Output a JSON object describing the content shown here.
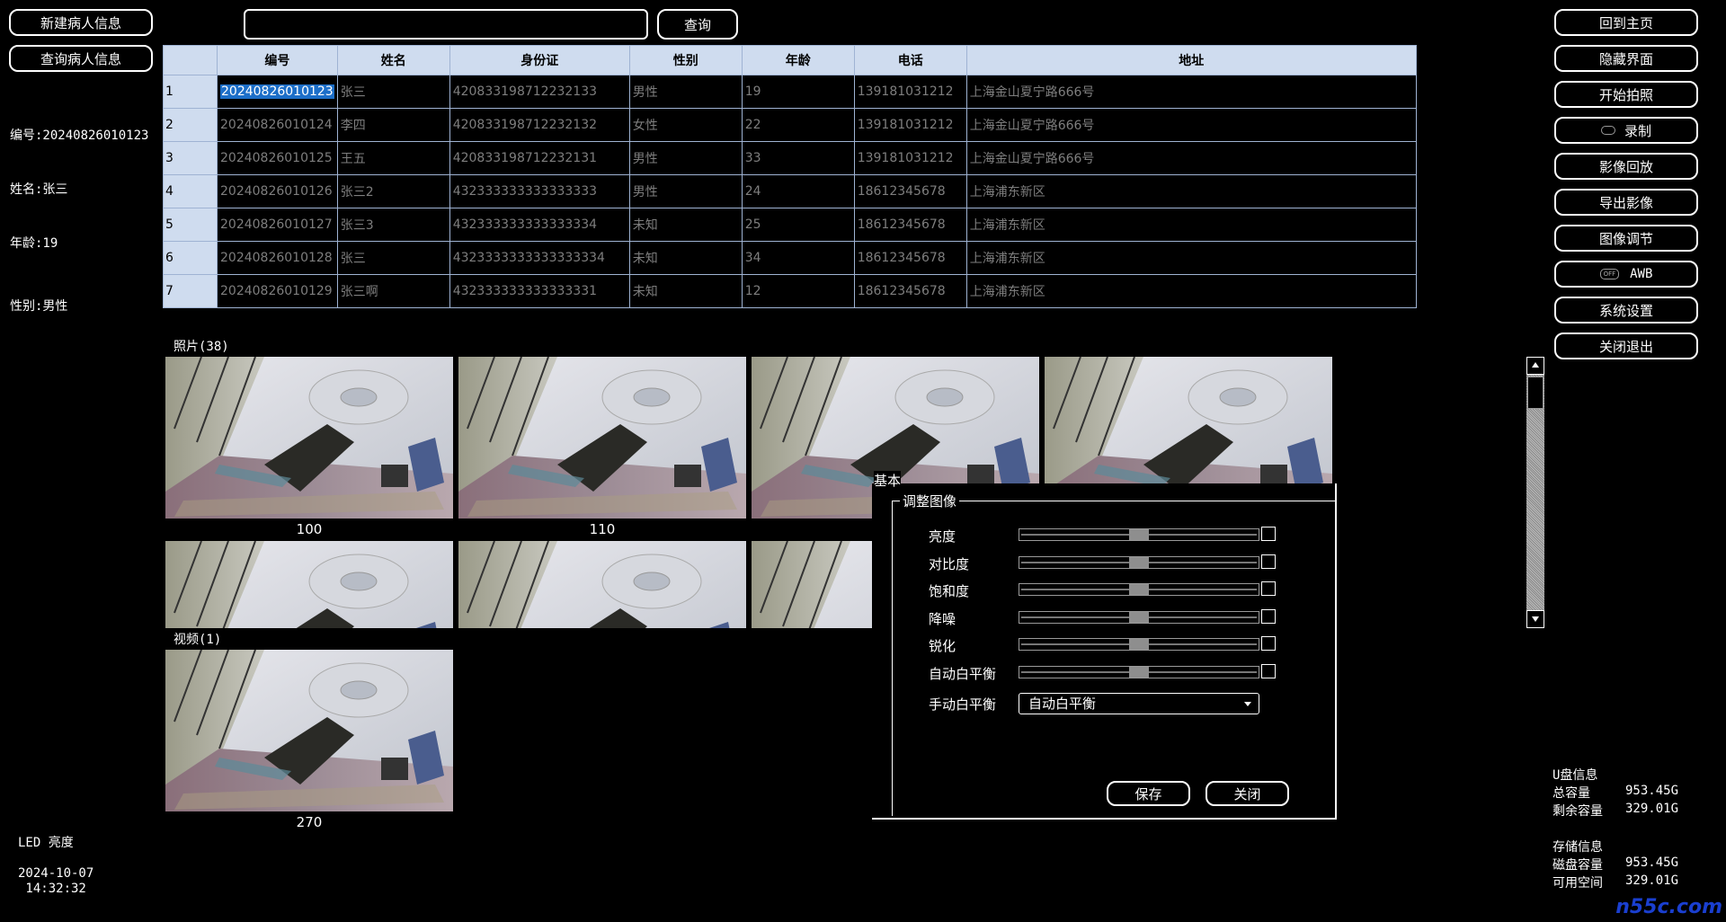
{
  "left_buttons": {
    "new_patient": "新建病人信息",
    "query_patient": "查询病人信息"
  },
  "search": {
    "value": "",
    "button": "查询"
  },
  "patient": {
    "id": "编号:20240826010123",
    "name": "姓名:张三",
    "age": "年龄:19",
    "sex": "性别:男性"
  },
  "table": {
    "headers": [
      "编号",
      "姓名",
      "身份证",
      "性别",
      "年龄",
      "电话",
      "地址"
    ],
    "rows": [
      {
        "n": "1",
        "id": "20240826010123",
        "name": "张三",
        "idcard": "420833198712232133",
        "sex": "男性",
        "age": "19",
        "phone": "139181031212",
        "addr": "上海金山夏宁路666号"
      },
      {
        "n": "2",
        "id": "20240826010124",
        "name": "李四",
        "idcard": "420833198712232132",
        "sex": "女性",
        "age": "22",
        "phone": "139181031212",
        "addr": "上海金山夏宁路666号"
      },
      {
        "n": "3",
        "id": "20240826010125",
        "name": "王五",
        "idcard": "420833198712232131",
        "sex": "男性",
        "age": "33",
        "phone": "139181031212",
        "addr": "上海金山夏宁路666号"
      },
      {
        "n": "4",
        "id": "20240826010126",
        "name": "张三2",
        "idcard": "432333333333333333",
        "sex": "男性",
        "age": "24",
        "phone": "18612345678",
        "addr": "上海浦东新区"
      },
      {
        "n": "5",
        "id": "20240826010127",
        "name": "张三3",
        "idcard": "432333333333333334",
        "sex": "未知",
        "age": "25",
        "phone": "18612345678",
        "addr": "上海浦东新区"
      },
      {
        "n": "6",
        "id": "20240826010128",
        "name": "张三",
        "idcard": "4323333333333333334",
        "sex": "未知",
        "age": "34",
        "phone": "18612345678",
        "addr": "上海浦东新区"
      },
      {
        "n": "7",
        "id": "20240826010129",
        "name": "张三啊",
        "idcard": "432333333333333331",
        "sex": "未知",
        "age": "12",
        "phone": "18612345678",
        "addr": "上海浦东新区"
      }
    ]
  },
  "photos": {
    "label": "照片(38)",
    "captions": [
      "100",
      "110"
    ]
  },
  "videos": {
    "label": "视频(1)",
    "captions": [
      "270"
    ]
  },
  "right_buttons": {
    "home": "回到主页",
    "hide": "隐藏界面",
    "photo": "开始拍照",
    "record": "录制",
    "playback": "影像回放",
    "export": "导出影像",
    "adjust": "图像调节",
    "awb": "AWB",
    "settings": "系统设置",
    "exit": "关闭退出",
    "off_badge": "OFF"
  },
  "panel": {
    "title": "基本",
    "group": "调整图像",
    "rows": [
      "亮度",
      "对比度",
      "饱和度",
      "降噪",
      "锐化",
      "自动白平衡"
    ],
    "levels": [
      0.5,
      0.5,
      0.5,
      0.5,
      0.5,
      0.5
    ],
    "wb_label": "手动白平衡",
    "wb_value": "自动白平衡",
    "save": "保存",
    "close": "关闭"
  },
  "bottom_left": {
    "led": "LED 亮度",
    "date": "2024-10-07",
    "time": " 14:32:32"
  },
  "storage": {
    "u_title": "U盘信息",
    "u_total_label": "总容量",
    "u_total": "953.45G",
    "u_free_label": "剩余容量",
    "u_free": "329.01G",
    "s_title": "存储信息",
    "s_total_label": "磁盘容量",
    "s_total": "953.45G",
    "s_free_label": "可用空间",
    "s_free": "329.01G"
  },
  "watermark": "n55c.com"
}
